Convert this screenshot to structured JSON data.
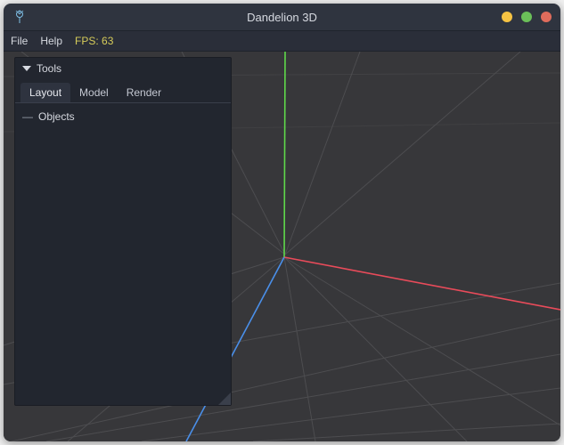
{
  "window": {
    "title": "Dandelion 3D"
  },
  "menubar": {
    "file": "File",
    "help": "Help",
    "fps_label": "FPS: 63"
  },
  "panel": {
    "title": "Tools",
    "tabs": {
      "layout": "Layout",
      "model": "Model",
      "render": "Render"
    },
    "active_tab": "layout",
    "tree": {
      "root": "Objects"
    }
  },
  "viewport": {
    "axis_colors": {
      "x": "#e94b5a",
      "y": "#5fd94a",
      "z": "#4a8fe9"
    },
    "grid_color": "#4d4d50",
    "background": "#37373a"
  }
}
